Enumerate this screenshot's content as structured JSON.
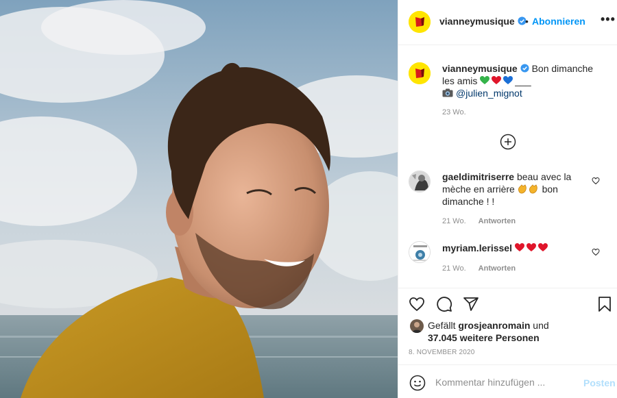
{
  "post": {
    "image_alt": "portrait photo",
    "header": {
      "username": "vianneymusique",
      "dot": "•",
      "follow_label": "Abonnieren",
      "more_label": "•••"
    },
    "caption": {
      "username": "vianneymusique",
      "text_1": "Bon dimanche les amis",
      "suffix": "___",
      "mention": "@julien_mignot",
      "time": "23 Wo."
    },
    "comments": [
      {
        "username": "gaeldimitriserre",
        "text_1": "beau avec la mèche en arrière",
        "text_2": "bon dimanche ! !",
        "time": "21 Wo.",
        "reply_label": "Antworten"
      },
      {
        "username": "myriam.lerissel",
        "text_1": "",
        "time": "21 Wo.",
        "reply_label": "Antworten"
      }
    ],
    "likes": {
      "prefix": "Gefällt",
      "user": "grosjeanromain",
      "and": "und",
      "others": "37.045 weitere Personen"
    },
    "date": "8. NOVEMBER 2020",
    "comment_box": {
      "placeholder": "Kommentar hinzufügen ...",
      "post_label": "Posten"
    }
  },
  "colors": {
    "link": "#0095f6",
    "mention": "#00376b",
    "muted": "#8e8e8e",
    "avatar_bg": "#ffe500",
    "post_disabled": "#b2dffc"
  },
  "icons": [
    "verified-icon",
    "more-icon",
    "add-comment-icon",
    "like-icon",
    "comment-icon",
    "share-icon",
    "save-icon",
    "emoji-icon",
    "camera-icon",
    "heart-emoji-icon",
    "clap-emoji-icon"
  ]
}
